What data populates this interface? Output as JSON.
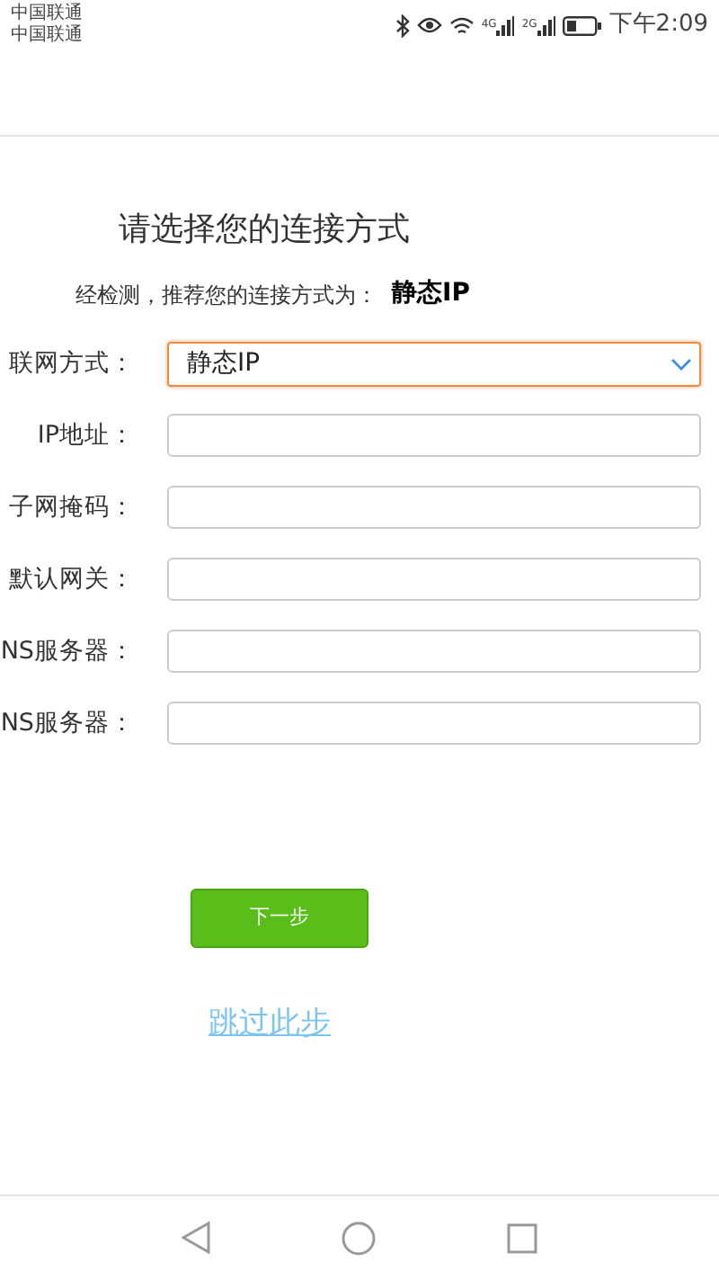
{
  "status_bar": {
    "carriers": [
      "中国联通",
      "中国联通"
    ],
    "network_labels": [
      "4G",
      "2G"
    ],
    "time": "下午2:09"
  },
  "title": "请选择您的连接方式",
  "detection": {
    "prompt": "经检测，推荐您的连接方式为：",
    "recommended": "静态IP"
  },
  "form": [
    {
      "kind": "select",
      "label": "联网方式：",
      "value": "静态IP",
      "focused": true
    },
    {
      "kind": "input",
      "label": "IP地址："
    },
    {
      "kind": "input",
      "label": "子网掩码："
    },
    {
      "kind": "input",
      "label": "默认网关："
    },
    {
      "kind": "input",
      "label": "NS服务器："
    },
    {
      "kind": "input",
      "label": "NS服务器："
    }
  ],
  "next_button": "下一步",
  "skip_link": "跳过此步"
}
